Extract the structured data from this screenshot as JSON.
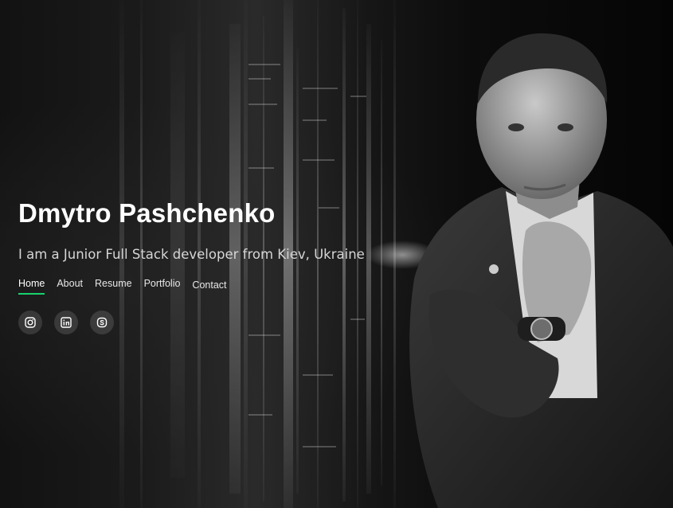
{
  "hero": {
    "name": "Dmytro Pashchenko",
    "tagline": "I am a Junior Full Stack developer from Kiev, Ukraine"
  },
  "nav": {
    "items": [
      {
        "label": "Home",
        "active": true
      },
      {
        "label": "About",
        "active": false
      },
      {
        "label": "Resume",
        "active": false
      },
      {
        "label": "Portfolio",
        "active": false
      },
      {
        "label": "Contact",
        "active": false
      }
    ]
  },
  "socials": [
    {
      "icon": "instagram-icon"
    },
    {
      "icon": "linkedin-icon"
    },
    {
      "icon": "skype-icon"
    }
  ],
  "colors": {
    "accent": "#18d26e",
    "text": "#ffffff",
    "muted": "#d6d6d6",
    "background": "#0a0a0a"
  }
}
